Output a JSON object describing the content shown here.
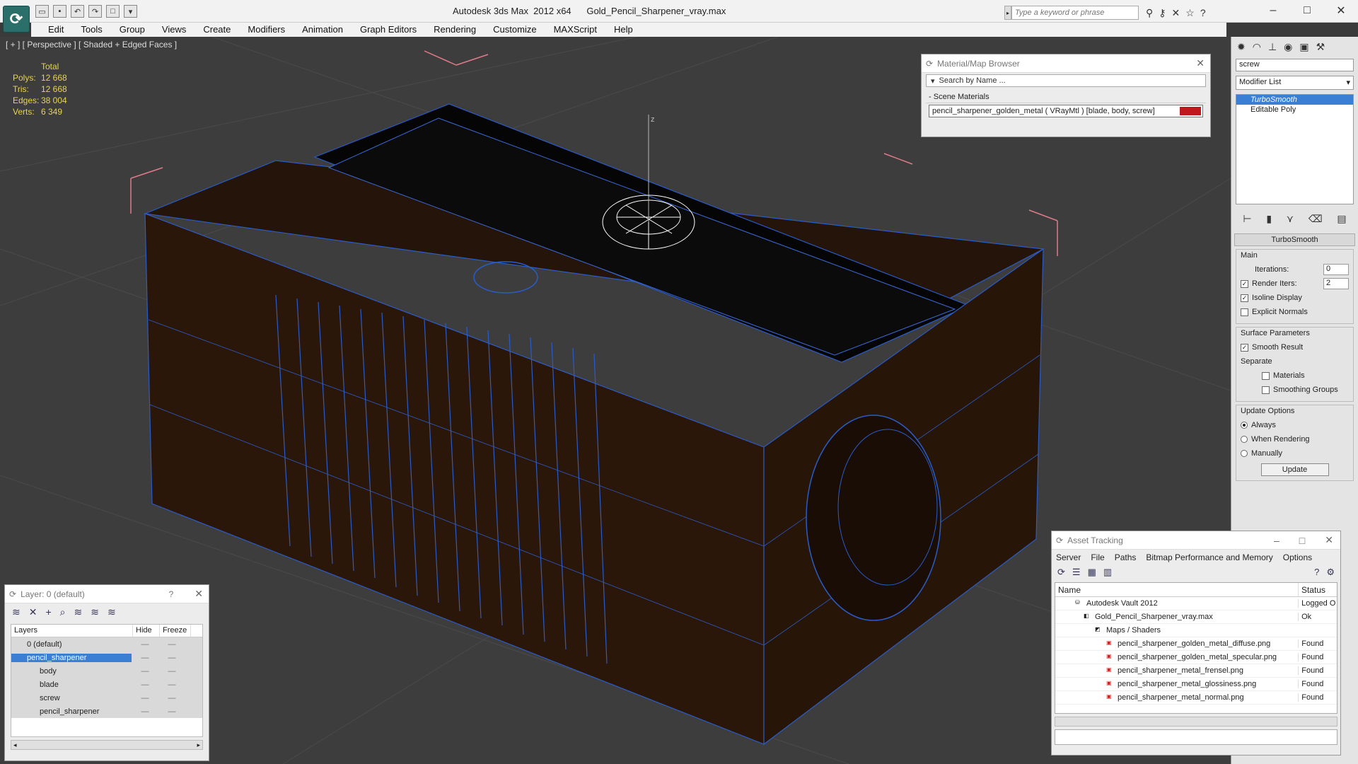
{
  "window": {
    "title": "Autodesk 3ds Max  2012 x64      Gold_Pencil_Sharpener_vray.max",
    "search_placeholder": "Type a keyword or phrase"
  },
  "menu": [
    "Edit",
    "Tools",
    "Group",
    "Views",
    "Create",
    "Modifiers",
    "Animation",
    "Graph Editors",
    "Rendering",
    "Customize",
    "MAXScript",
    "Help"
  ],
  "viewport": {
    "label": "[ + ] [ Perspective ] [ Shaded + Edged Faces ]",
    "stats": {
      "header": "Total",
      "rows": [
        {
          "key": "Polys:",
          "val": "12 668"
        },
        {
          "key": "Tris:",
          "val": "12 668"
        },
        {
          "key": "Edges:",
          "val": "38 004"
        },
        {
          "key": "Verts:",
          "val": "6 349"
        }
      ]
    }
  },
  "material_browser": {
    "title": "Material/Map Browser",
    "search": "Search by Name ...",
    "section": "Scene Materials",
    "material": "pencil_sharpener_golden_metal  ( VRayMtl )  [blade, body, screw]",
    "swatch_color": "#c0181c"
  },
  "command_panel": {
    "object_name": "screw",
    "modifier_list": "Modifier List",
    "stack": [
      {
        "label": "TurboSmooth",
        "selected": true
      },
      {
        "label": "Editable Poly",
        "selected": false
      }
    ],
    "rollout": "TurboSmooth",
    "main_group": "Main",
    "iterations_label": "Iterations:",
    "iterations_value": "0",
    "render_iters_label": "Render Iters:",
    "render_iters_value": "2",
    "isoline_label": "Isoline Display",
    "explicit_normals_label": "Explicit Normals",
    "surface_group": "Surface Parameters",
    "smooth_result_label": "Smooth Result",
    "separate_label": "Separate",
    "materials_label": "Materials",
    "smoothing_groups_label": "Smoothing Groups",
    "update_group": "Update Options",
    "always_label": "Always",
    "when_rendering_label": "When Rendering",
    "manually_label": "Manually",
    "update_button": "Update"
  },
  "layer_panel": {
    "title": "Layer: 0 (default)",
    "help": "?",
    "col_layers": "Layers",
    "col_hide": "Hide",
    "col_freeze": "Freeze",
    "rows": [
      {
        "name": "0 (default)",
        "indent": 0
      },
      {
        "name": "pencil_sharpener",
        "indent": 0
      },
      {
        "name": "body",
        "indent": 1
      },
      {
        "name": "blade",
        "indent": 1
      },
      {
        "name": "screw",
        "indent": 1
      },
      {
        "name": "pencil_sharpener",
        "indent": 1
      }
    ]
  },
  "asset_tracking": {
    "title": "Asset Tracking",
    "menu": [
      "Server",
      "File",
      "Paths",
      "Bitmap Performance and Memory",
      "Options"
    ],
    "col_name": "Name",
    "col_status": "Status",
    "rows": [
      {
        "name": "Autodesk Vault 2012",
        "status": "Logged O",
        "indent": 1
      },
      {
        "name": "Gold_Pencil_Sharpener_vray.max",
        "status": "Ok",
        "indent": 2
      },
      {
        "name": "Maps / Shaders",
        "status": "",
        "indent": 3
      },
      {
        "name": "pencil_sharpener_golden_metal_diffuse.png",
        "status": "Found",
        "indent": 4
      },
      {
        "name": "pencil_sharpener_golden_metal_specular.png",
        "status": "Found",
        "indent": 4
      },
      {
        "name": "pencil_sharpener_metal_frensel.png",
        "status": "Found",
        "indent": 4
      },
      {
        "name": "pencil_sharpener_metal_glossiness.png",
        "status": "Found",
        "indent": 4
      },
      {
        "name": "pencil_sharpener_metal_normal.png",
        "status": "Found",
        "indent": 4
      }
    ]
  },
  "colors": {
    "wire": "#2a5cc8",
    "body": "#2a1608",
    "stats": "#e8d44d",
    "selection": "#3b7fd4"
  }
}
